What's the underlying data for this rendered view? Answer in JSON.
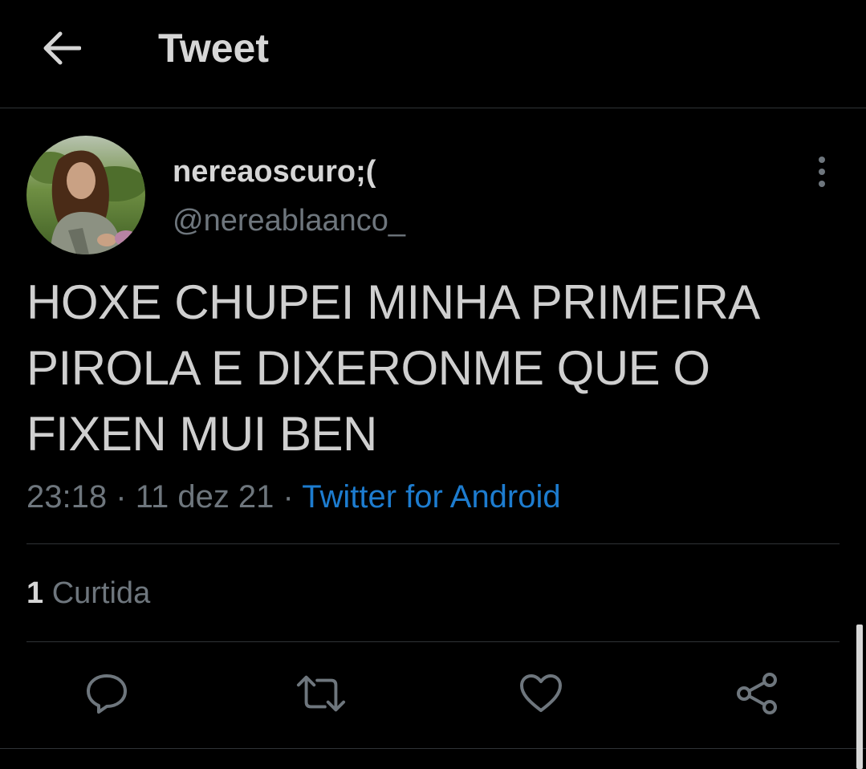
{
  "header": {
    "title": "Tweet",
    "back_icon": "arrow-left-icon"
  },
  "author": {
    "display_name": "nereaoscuro;(",
    "handle": "@nereablaanco_",
    "avatar": "profile-photo"
  },
  "tweet": {
    "text": "HOXE CHUPEI MINHA PRIMEIRA PIROLA E DIXERONME QUE O FIXEN MUI BEN",
    "time": "23:18",
    "separator": "·",
    "date": "11 dez 21",
    "source": "Twitter for Android"
  },
  "stats": {
    "likes_count": "1",
    "likes_label": "Curtida"
  },
  "actions": {
    "reply_icon": "comment-icon",
    "retweet_icon": "retweet-icon",
    "like_icon": "heart-icon",
    "share_icon": "share-icon"
  },
  "colors": {
    "background": "#000000",
    "text_primary": "#d6d6d6",
    "text_secondary": "#6e767d",
    "link": "#1d7ccf",
    "border": "#2f3336"
  }
}
